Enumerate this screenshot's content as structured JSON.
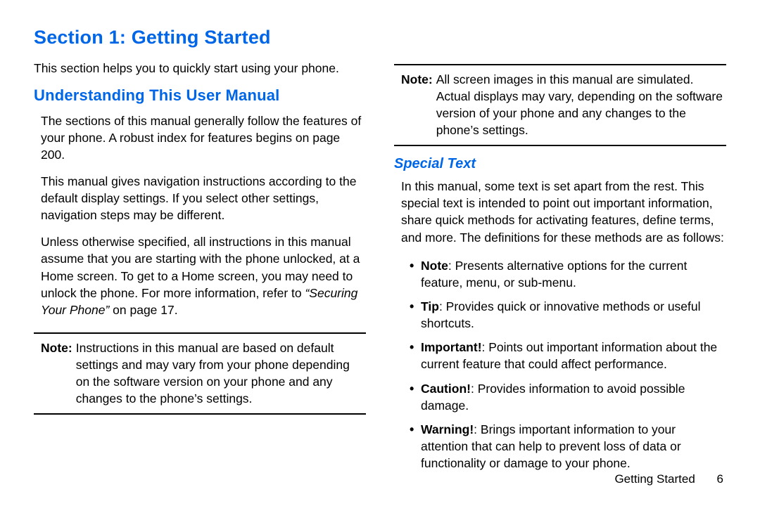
{
  "section_title": "Section 1: Getting Started",
  "left": {
    "intro": "This section helps you to quickly start using your phone.",
    "h2": "Understanding This User Manual",
    "p1": "The sections of this manual generally follow the features of your phone. A robust index for features begins on page 200.",
    "p2": "This manual gives navigation instructions according to the default display settings. If you select other settings, navigation steps may be different.",
    "p3_a": "Unless otherwise specified, all instructions in this manual assume that you are starting with the phone unlocked, at a Home screen. To get to a Home screen, you may need to unlock the phone. For more information, refer to ",
    "p3_xref": "“Securing Your Phone”",
    "p3_b": " on page 17.",
    "note1_label": "Note:",
    "note1_text": " Instructions in this manual are based on default settings and may vary from your phone depending on the software version on your phone and any changes to the phone’s settings."
  },
  "right": {
    "note2_label": "Note:",
    "note2_text": " All screen images in this manual are simulated. Actual displays may vary, depending on the software version of your phone and any changes to the phone’s settings.",
    "h3": "Special Text",
    "p1": "In this manual, some text is set apart from the rest. This special text is intended to point out important information, share quick methods for activating features, define terms, and more. The definitions for these methods are as follows:",
    "bullets": [
      {
        "kw": "Note",
        "text": ": Presents alternative options for the current feature, menu, or sub-menu."
      },
      {
        "kw": "Tip",
        "text": ": Provides quick or innovative methods or useful shortcuts."
      },
      {
        "kw": "Important!",
        "text": ": Points out important information about the current feature that could affect performance."
      },
      {
        "kw": "Caution!",
        "text": ": Provides information to avoid possible damage."
      },
      {
        "kw": "Warning!",
        "text": ": Brings important information to your attention that can help to prevent loss of data or functionality or damage to your phone."
      }
    ]
  },
  "footer": {
    "label": "Getting Started",
    "page": "6"
  }
}
